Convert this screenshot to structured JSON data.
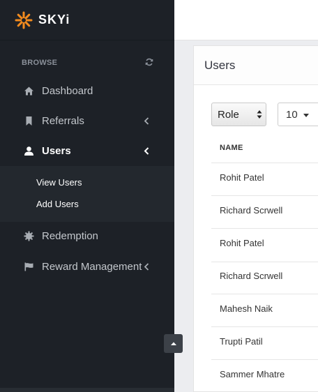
{
  "brand": {
    "name": "SKYi",
    "accent": "#f28b1e"
  },
  "sidebar": {
    "section_label": "BROWSE",
    "items": [
      {
        "label": "Dashboard",
        "icon": "home-icon"
      },
      {
        "label": "Referrals",
        "icon": "bookmark-icon",
        "has_caret": true
      },
      {
        "label": "Users",
        "icon": "user-icon",
        "has_caret": true,
        "active": true
      },
      {
        "label": "Redemption",
        "icon": "gear-icon"
      },
      {
        "label": "Reward Management",
        "icon": "flag-icon",
        "has_caret": true
      }
    ],
    "submenu": [
      {
        "label": "View Users"
      },
      {
        "label": "Add Users"
      }
    ]
  },
  "panel": {
    "title": "Users",
    "role_filter": "Role",
    "page_size": "10",
    "table": {
      "columns": [
        "NAME"
      ],
      "rows": [
        "Rohit Patel",
        "Richard Scrwell",
        "Rohit Patel",
        "Richard Scrwell",
        "Mahesh Naik",
        "Trupti Patil",
        "Sammer Mhatre"
      ]
    }
  }
}
